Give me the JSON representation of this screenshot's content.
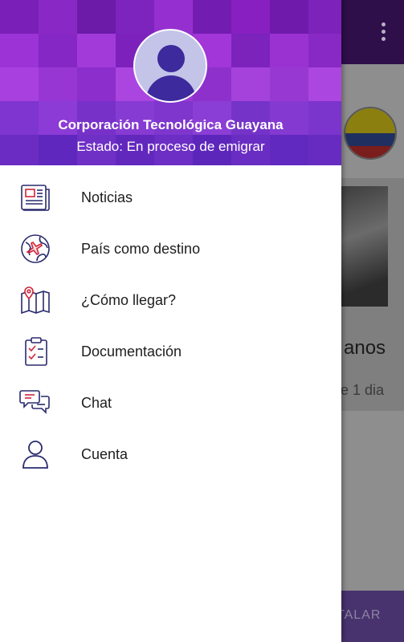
{
  "header": {
    "organization": "Corporación Tecnológica Guayana",
    "status": "Estado: En proceso de emigrar"
  },
  "menu": {
    "items": [
      {
        "label": "Noticias",
        "icon": "newspaper-icon"
      },
      {
        "label": "País como destino",
        "icon": "globe-plane-icon"
      },
      {
        "label": "¿Cómo llegar?",
        "icon": "map-pin-icon"
      },
      {
        "label": "Documentación",
        "icon": "clipboard-checklist-icon"
      },
      {
        "label": "Chat",
        "icon": "chat-bubbles-icon"
      },
      {
        "label": "Cuenta",
        "icon": "user-account-icon"
      }
    ]
  },
  "background": {
    "card_title_fragment": "anos",
    "card_time_fragment": "e 1 dia",
    "install_fragment": "TALAR"
  },
  "colors": {
    "header_purple": "#6a2bc9",
    "icon_navy": "#2a2a6e",
    "icon_red": "#d0243a",
    "topbar": "#2e0f4a"
  }
}
